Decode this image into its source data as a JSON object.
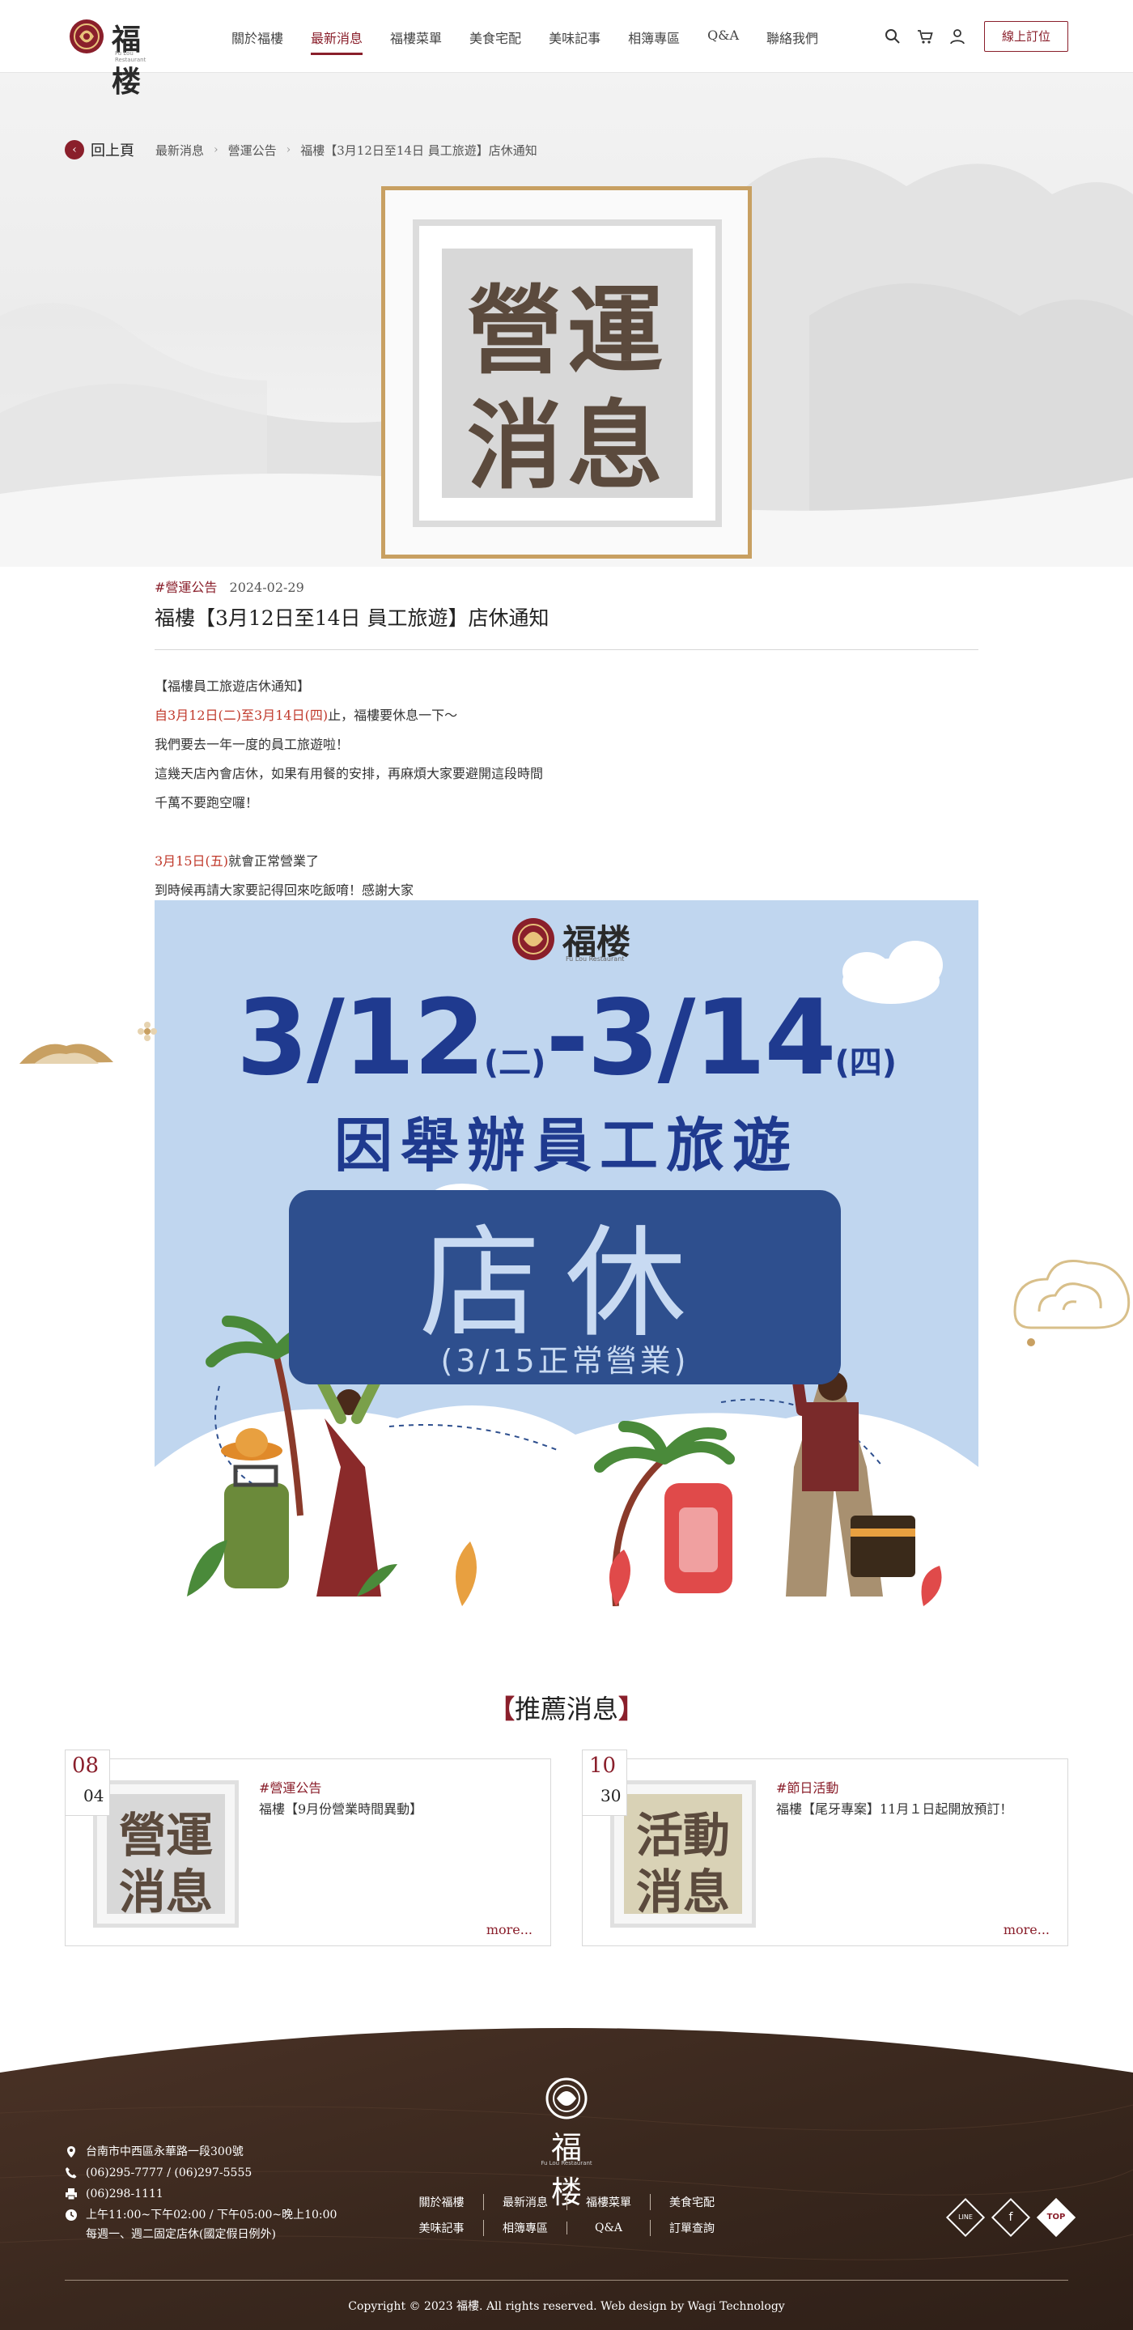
{
  "header": {
    "brand": "福楼",
    "brand_sub": "Fu Lou Restaurant",
    "nav": [
      "關於福樓",
      "最新消息",
      "福樓菜單",
      "美食宅配",
      "美味記事",
      "相簿專區",
      "Q&A",
      "聯絡我們"
    ],
    "active_nav": "最新消息",
    "order_button": "線上訂位"
  },
  "breadcrumb": {
    "back_label": "回上頁",
    "items": [
      "最新消息",
      "營運公告",
      "福樓【3月12日至14日 員工旅遊】店休通知"
    ]
  },
  "cover": {
    "line1": "營運",
    "line2": "消息"
  },
  "article": {
    "tag": "#營運公告",
    "date": "2024-02-29",
    "title": "福樓【3月12日至14日 員工旅遊】店休通知",
    "p1": "【福樓員工旅遊店休通知】",
    "p2_pre": "自",
    "p2_red": "3月12日(二)至3月14日(四)",
    "p2_post": "止，福樓要休息一下～",
    "p3": "我們要去一年一度的員工旅遊啦！",
    "p4": "這幾天店內會店休，如果有用餐的安排，再麻煩大家要避開這段時間",
    "p5": "千萬不要跑空囉！",
    "p6_red": "3月15日(五)",
    "p6_post": "就會正常營業了",
    "p7": "到時候再請大家要記得回來吃飯唷！感謝大家"
  },
  "poster": {
    "brand": "福楼",
    "brand_sub": "Fu Lou Restaurant",
    "date_start": "3/12",
    "date_start_day": "(二)",
    "dash": "-",
    "date_end": "3/14",
    "date_end_day": "(四)",
    "reason": "因舉辦員工旅遊",
    "closed": "店休",
    "reopen": "(3/15正常營業)"
  },
  "recommended": {
    "bracket_left": "【",
    "title": "推薦消息",
    "bracket_right": "】",
    "cards": [
      {
        "month": "08",
        "day": "04",
        "thumb_line1": "營運",
        "thumb_line2": "消息",
        "tag": "#營運公告",
        "title": "福樓【9月份營業時間異動】",
        "more": "more..."
      },
      {
        "month": "10",
        "day": "30",
        "thumb_line1": "活動",
        "thumb_line2": "消息",
        "tag": "#節日活動",
        "title": "福樓【尾牙專案】11月１日起開放預訂！",
        "more": "more..."
      }
    ]
  },
  "footer": {
    "brand": "福楼",
    "brand_sub": "Fu Lou Restaurant",
    "address": "台南市中西區永華路一段300號",
    "phone": "(06)295-7777 / (06)297-5555",
    "fax": "(06)298-1111",
    "hours": "上午11:00~下午02:00 / 下午05:00~晚上10:00",
    "hours_note": "每週一、週二固定店休(國定假日例外)",
    "nav_row1": [
      "關於福樓",
      "最新消息",
      "福樓菜單",
      "美食宅配"
    ],
    "nav_row2": [
      "美味記事",
      "相簿專區",
      "Q&A",
      "訂單查詢"
    ],
    "social_line": "LINE",
    "social_fb": "f",
    "top_label": "TOP",
    "copyright": "Copyright © 2023 福樓. All rights reserved. Web design by Wagi Technology"
  },
  "colors": {
    "brand_red": "#8a1f2b",
    "gold": "#c8a062",
    "footer_brown": "#3d2a20",
    "poster_blue": "#1f3a8f"
  },
  "icons": [
    "search-icon",
    "cart-icon",
    "user-icon",
    "chevron-left-icon",
    "location-icon",
    "phone-icon",
    "fax-icon",
    "clock-icon",
    "line-icon",
    "facebook-icon",
    "top-icon"
  ]
}
